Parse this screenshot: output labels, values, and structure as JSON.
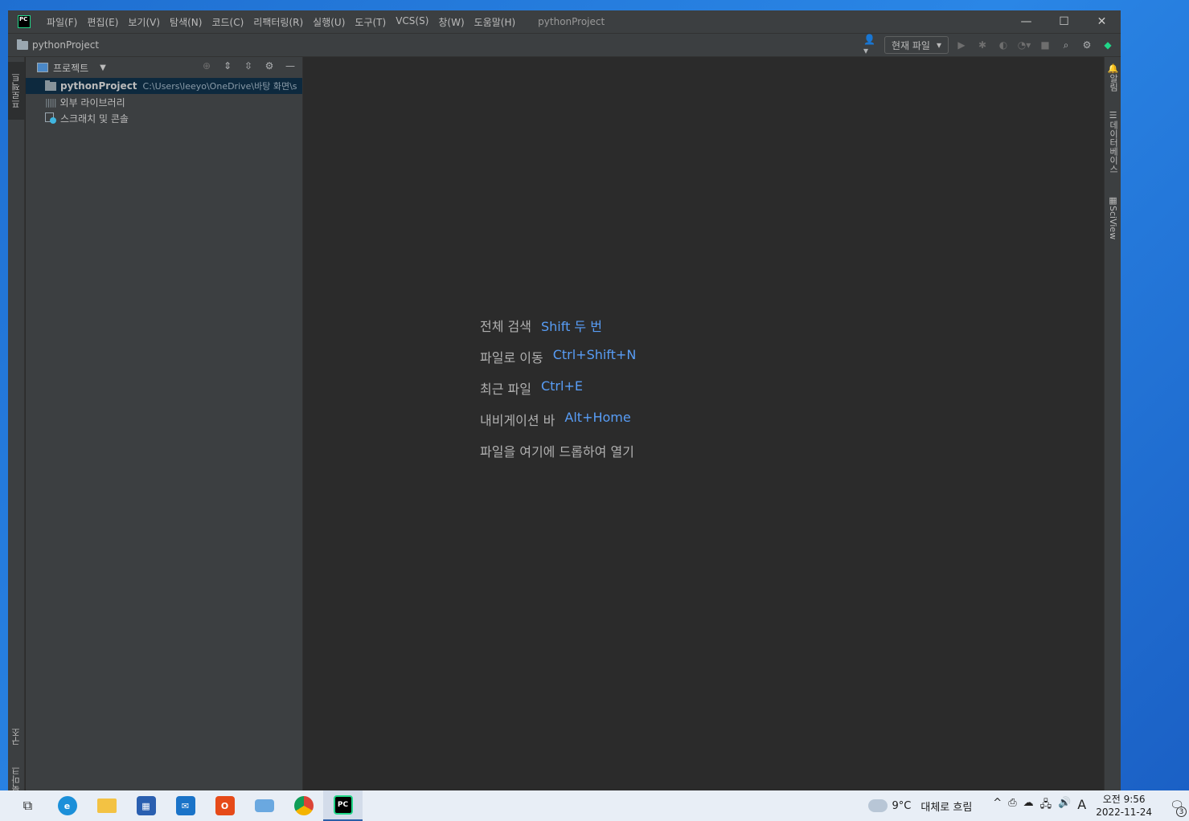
{
  "window": {
    "menu": [
      "파일(F)",
      "편집(E)",
      "보기(V)",
      "탐색(N)",
      "코드(C)",
      "리팩터링(R)",
      "실행(U)",
      "도구(T)",
      "VCS(S)",
      "창(W)",
      "도움말(H)"
    ],
    "title": "pythonProject",
    "controls": {
      "minimize": "—",
      "maximize": "☐",
      "close": "✕"
    }
  },
  "navbar": {
    "breadcrumb": "pythonProject",
    "config_select": "현재 파일"
  },
  "left_stripe": {
    "project": "프로젝트",
    "structure": "구조",
    "bookmarks": "북마크"
  },
  "right_stripe": {
    "notifications": "알림",
    "database": "데이터베이스",
    "sciview": "SciView"
  },
  "project_panel": {
    "title": "프로젝트",
    "tree": [
      {
        "name": "pythonProject",
        "path": "C:\\Users\\leeyo\\OneDrive\\바탕 화면\\s"
      },
      {
        "name": "외부 라이브러리"
      },
      {
        "name": "스크래치 및 콘솔"
      }
    ]
  },
  "editor": {
    "hints": [
      {
        "label": "전체 검색",
        "key": "Shift 두 번"
      },
      {
        "label": "파일로 이동",
        "key": "Ctrl+Shift+N"
      },
      {
        "label": "최근 파일",
        "key": "Ctrl+E"
      },
      {
        "label": "내비게이션 바",
        "key": "Alt+Home"
      },
      {
        "label": "파일을 여기에 드롭하여 열기",
        "key": ""
      }
    ]
  },
  "taskbar": {
    "weather": {
      "temp": "9°C",
      "desc": "대체로 흐림"
    },
    "ime": "A",
    "clock": {
      "time": "오전 9:56",
      "date": "2022-11-24"
    },
    "notification_count": "3"
  },
  "colors": {
    "accent": "#589df6",
    "selection": "#0d293e",
    "panel_bg": "#3c3f41",
    "editor_bg": "#2b2b2b"
  }
}
